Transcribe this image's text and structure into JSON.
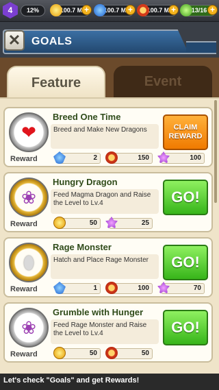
{
  "topbar": {
    "level": "4",
    "xp": "12%",
    "coins": "100.7 M",
    "gems": "100.7 M",
    "food": "100.7 M",
    "treats": "13/16"
  },
  "header": {
    "title": "GOALS",
    "close_icon": "crossed-swords-icon"
  },
  "tabs": [
    {
      "label": "Feature",
      "active": true
    },
    {
      "label": "Event",
      "active": false
    }
  ],
  "goals": [
    {
      "title": "Breed One Time",
      "description": "Breed and Make New Dragons",
      "icon": "heart-icon",
      "medal": "silver",
      "reward_label": "Reward",
      "rewards": [
        {
          "type": "gem",
          "amount": "2"
        },
        {
          "type": "food",
          "amount": "150"
        },
        {
          "type": "treat",
          "amount": "100"
        }
      ],
      "button": {
        "label": "CLAIM REWARD",
        "style": "orange"
      }
    },
    {
      "title": "Hungry Dragon",
      "description": "Feed Magma Dragon and Raise the Level to Lv.4",
      "icon": "food-basket-icon",
      "medal": "gold",
      "reward_label": "Reward",
      "rewards": [
        {
          "type": "coin",
          "amount": "50"
        },
        {
          "type": "treat",
          "amount": "25"
        }
      ],
      "button": {
        "label": "GO!",
        "style": "green"
      }
    },
    {
      "title": "Rage Monster",
      "description": "Hatch and Place Rage Monster",
      "icon": "egg-icon",
      "medal": "gold",
      "reward_label": "Reward",
      "rewards": [
        {
          "type": "gem",
          "amount": "1"
        },
        {
          "type": "food",
          "amount": "100"
        },
        {
          "type": "treat",
          "amount": "70"
        }
      ],
      "button": {
        "label": "GO!",
        "style": "green"
      }
    },
    {
      "title": "Grumble with Hunger",
      "description": "Feed Rage Monster and Raise the Level to Lv.4",
      "icon": "food-basket-icon",
      "medal": "silver",
      "reward_label": "Reward",
      "rewards": [
        {
          "type": "coin",
          "amount": "50"
        },
        {
          "type": "food",
          "amount": "50"
        }
      ],
      "button": {
        "label": "GO!",
        "style": "green"
      }
    }
  ],
  "footer": {
    "message": "Let's check \"Goals\" and get Rewards!"
  },
  "colors": {
    "go_green": "#37b51a",
    "claim_orange": "#f07a00",
    "header_blue": "#23486f"
  }
}
